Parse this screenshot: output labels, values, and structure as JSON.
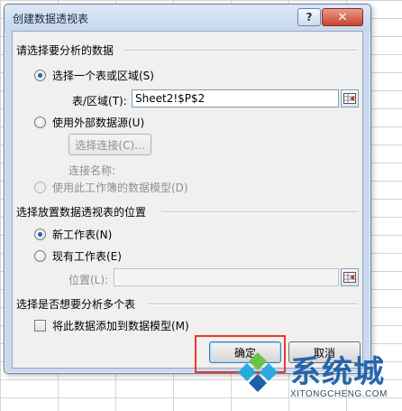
{
  "window": {
    "title": "创建数据透视表",
    "help_label": "?",
    "close_label": "✕"
  },
  "section_data": {
    "title": "请选择要分析的数据",
    "option_select_range": "选择一个表或区域(S)",
    "range_label": "表/区域(T):",
    "range_value": "Sheet2!$P$2",
    "option_external": "使用外部数据源(U)",
    "choose_connection_label": "选择连接(C)...",
    "connection_name_label": "连接名称:",
    "option_data_model": "使用此工作簿的数据模型(D)"
  },
  "section_location": {
    "title": "选择放置数据透视表的位置",
    "option_new_sheet": "新工作表(N)",
    "option_existing_sheet": "现有工作表(E)",
    "location_label": "位置(L):",
    "location_value": ""
  },
  "section_multi": {
    "title": "选择是否想要分析多个表",
    "add_to_model_label": "将此数据添加到数据模型(M)"
  },
  "buttons": {
    "ok_label": "确定",
    "cancel_label": "取消"
  },
  "watermark": {
    "brand": "系统城",
    "url": "XITONGCHENG.COM"
  },
  "colors": {
    "highlight": "#e83b2c",
    "radio_selected": "#1f5dbb",
    "watermark_blue": "#1d5fa8",
    "watermark_green": "#6cc04a"
  }
}
